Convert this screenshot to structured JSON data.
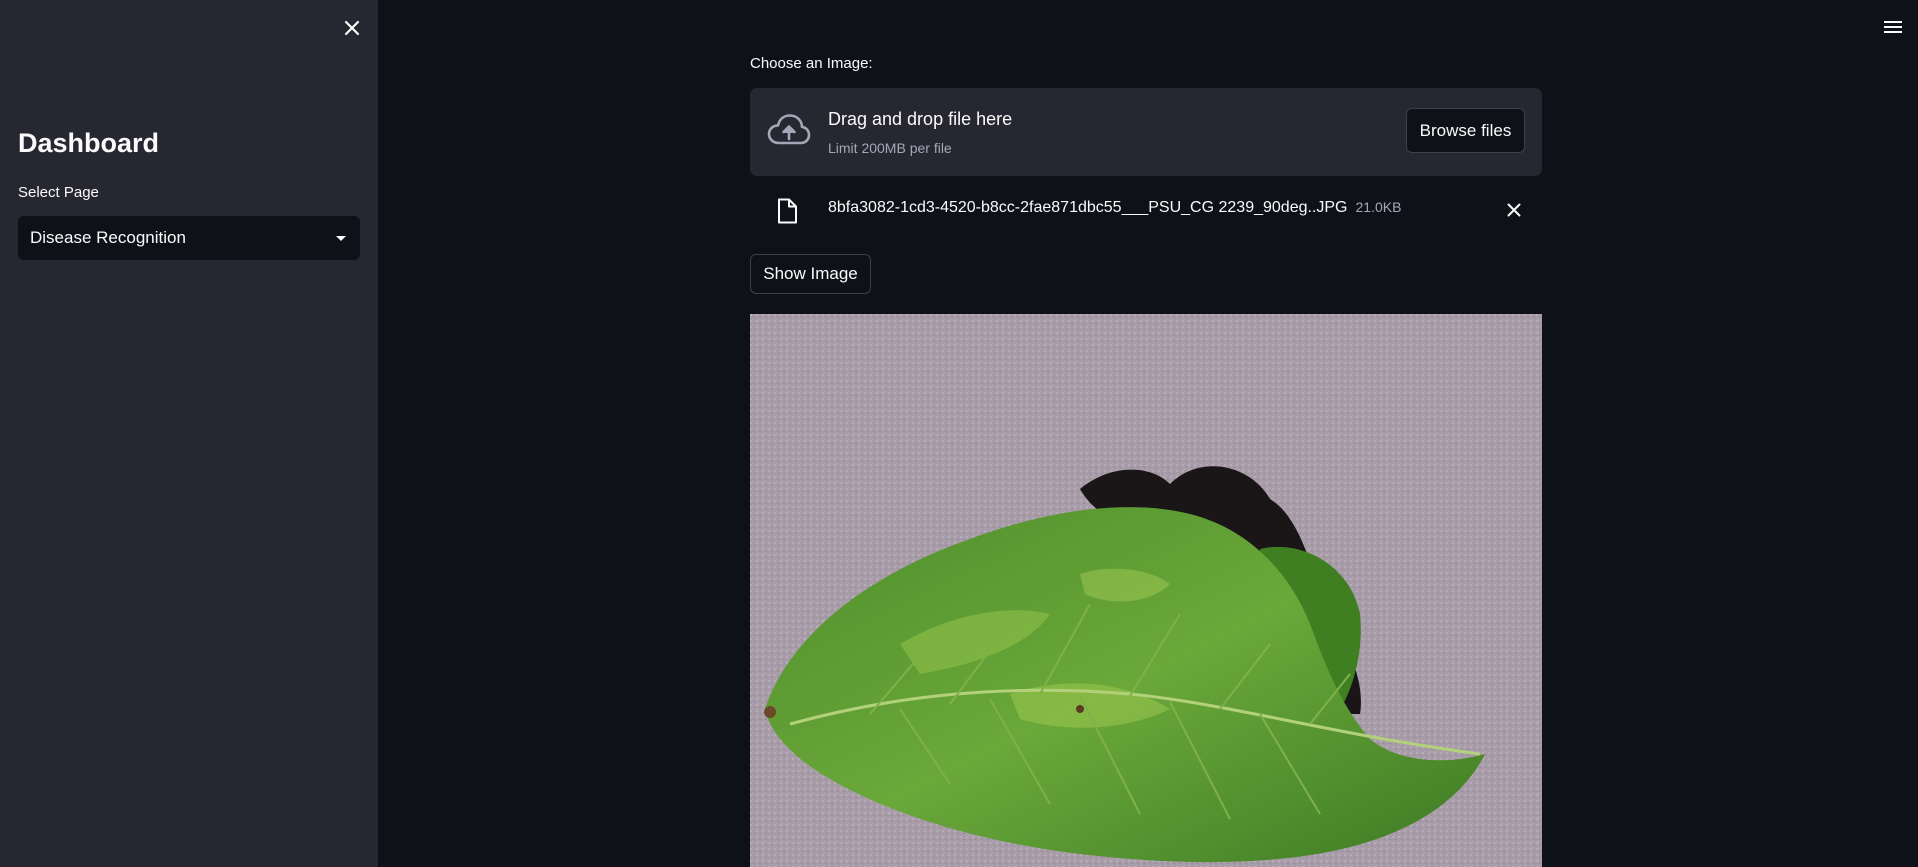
{
  "sidebar": {
    "title": "Dashboard",
    "select_label": "Select Page",
    "select_value": "Disease Recognition",
    "close_icon": "close-icon"
  },
  "header": {
    "menu_icon": "hamburger-menu-icon"
  },
  "uploader": {
    "label": "Choose an Image:",
    "drop_title": "Drag and drop file here",
    "drop_limit": "Limit 200MB per file",
    "browse_label": "Browse files",
    "file": {
      "name": "8bfa3082-1cd3-4520-b8cc-2fae871dbc55___PSU_CG 2239_90deg..JPG",
      "size": "21.0KB"
    }
  },
  "actions": {
    "show_image_label": "Show Image"
  },
  "colors": {
    "background": "#0e1117",
    "sidebar": "#262730",
    "dropzone": "#262730",
    "text": "#fafafa",
    "muted_text": "#a3a8b8",
    "leaf_green": "#5a9a32"
  }
}
